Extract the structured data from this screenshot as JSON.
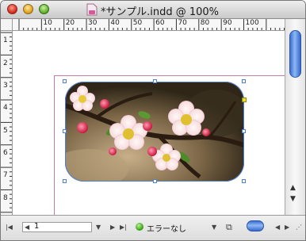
{
  "window": {
    "title": "*サンプル.indd @ 100%",
    "doc_icon": "indesign-doc-icon"
  },
  "rulers": {
    "horizontal_labels": [
      "10",
      "20",
      "30",
      "40",
      "50",
      "60",
      "70",
      "80",
      "90",
      "100"
    ],
    "vertical_labels": [
      "1",
      "2",
      "3",
      "4",
      "5",
      "6",
      "7",
      "8",
      "9"
    ]
  },
  "canvas": {
    "image": "plum-blossom-photo",
    "frame_shape": "rounded-rectangle"
  },
  "statusbar": {
    "page_number": "1",
    "preflight_status": "エラーなし",
    "preflight_color": "#2f9a12"
  },
  "colors": {
    "selection": "#4f7fd0",
    "margin_guide": "#c77aa7",
    "scroll_accent": "#3b6fd6"
  }
}
